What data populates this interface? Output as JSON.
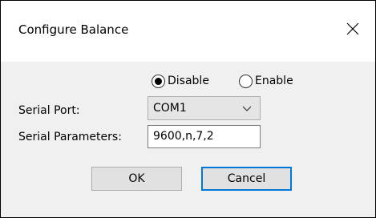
{
  "window": {
    "title": "Configure Balance",
    "close_icon": "close-icon"
  },
  "mode": {
    "options": [
      {
        "label": "Disable",
        "selected": true
      },
      {
        "label": "Enable",
        "selected": false
      }
    ]
  },
  "serial_port": {
    "label": "Serial Port:",
    "value": "COM1"
  },
  "serial_parameters": {
    "label": "Serial Parameters:",
    "value": "9600,n,7,2"
  },
  "buttons": {
    "ok_label": "OK",
    "cancel_label": "Cancel"
  },
  "colors": {
    "focus_border": "#0078d7",
    "dialog_bg": "#f0f0f0"
  }
}
